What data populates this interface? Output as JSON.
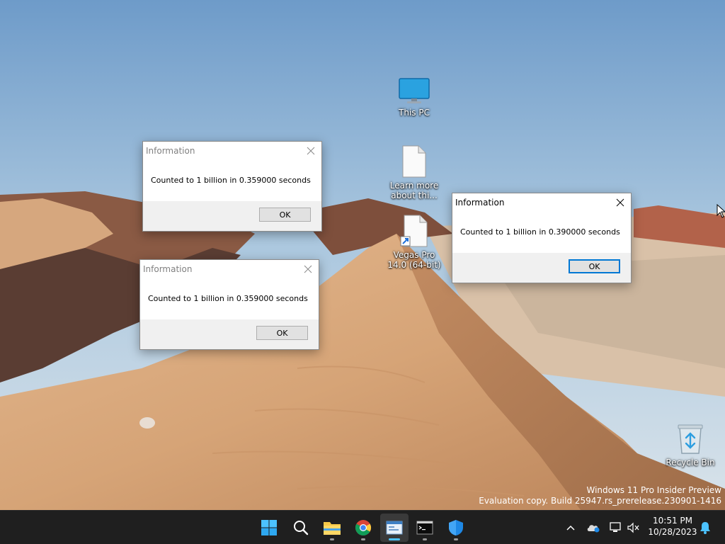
{
  "desktop": {
    "icons": [
      {
        "label": "This PC",
        "icon": "monitor-icon"
      },
      {
        "label": "Learn more about thi...",
        "icon": "document-icon"
      },
      {
        "label": "Vegas Pro 14.0 (64-bit)",
        "icon": "shortcut-document-icon"
      },
      {
        "label": "Recycle Bin",
        "icon": "recycle-bin-icon"
      }
    ]
  },
  "dialogs": [
    {
      "title": "Information",
      "message": "Counted to 1 billion in 0.359000 seconds",
      "ok_label": "OK",
      "active": false
    },
    {
      "title": "Information",
      "message": "Counted to 1 billion in 0.359000 seconds",
      "ok_label": "OK",
      "active": false
    },
    {
      "title": "Information",
      "message": "Counted to 1 billion in 0.390000 seconds",
      "ok_label": "OK",
      "active": true
    }
  ],
  "watermark": {
    "line1": "Windows 11 Pro Insider Preview",
    "line2": "Evaluation copy. Build 25947.rs_prerelease.230901-1416"
  },
  "taskbar": {
    "apps": [
      {
        "name": "start-button",
        "icon": "windows-logo-icon"
      },
      {
        "name": "search-button",
        "icon": "search-icon"
      },
      {
        "name": "file-explorer",
        "icon": "folder-icon"
      },
      {
        "name": "chrome",
        "icon": "chrome-icon"
      },
      {
        "name": "active-app",
        "icon": "app-window-icon"
      },
      {
        "name": "terminal",
        "icon": "terminal-icon"
      },
      {
        "name": "windows-security",
        "icon": "shield-icon"
      }
    ],
    "tray": [
      "chevron-up-icon",
      "onedrive-icon",
      "network-icon",
      "volume-muted-icon",
      "notification-bell-icon"
    ],
    "clock": {
      "time": "10:51 PM",
      "date": "10/28/2023"
    }
  },
  "colors": {
    "accent": "#0078d4",
    "taskbar": "#1f1f1f",
    "dialog_footer": "#f0f0f0"
  }
}
